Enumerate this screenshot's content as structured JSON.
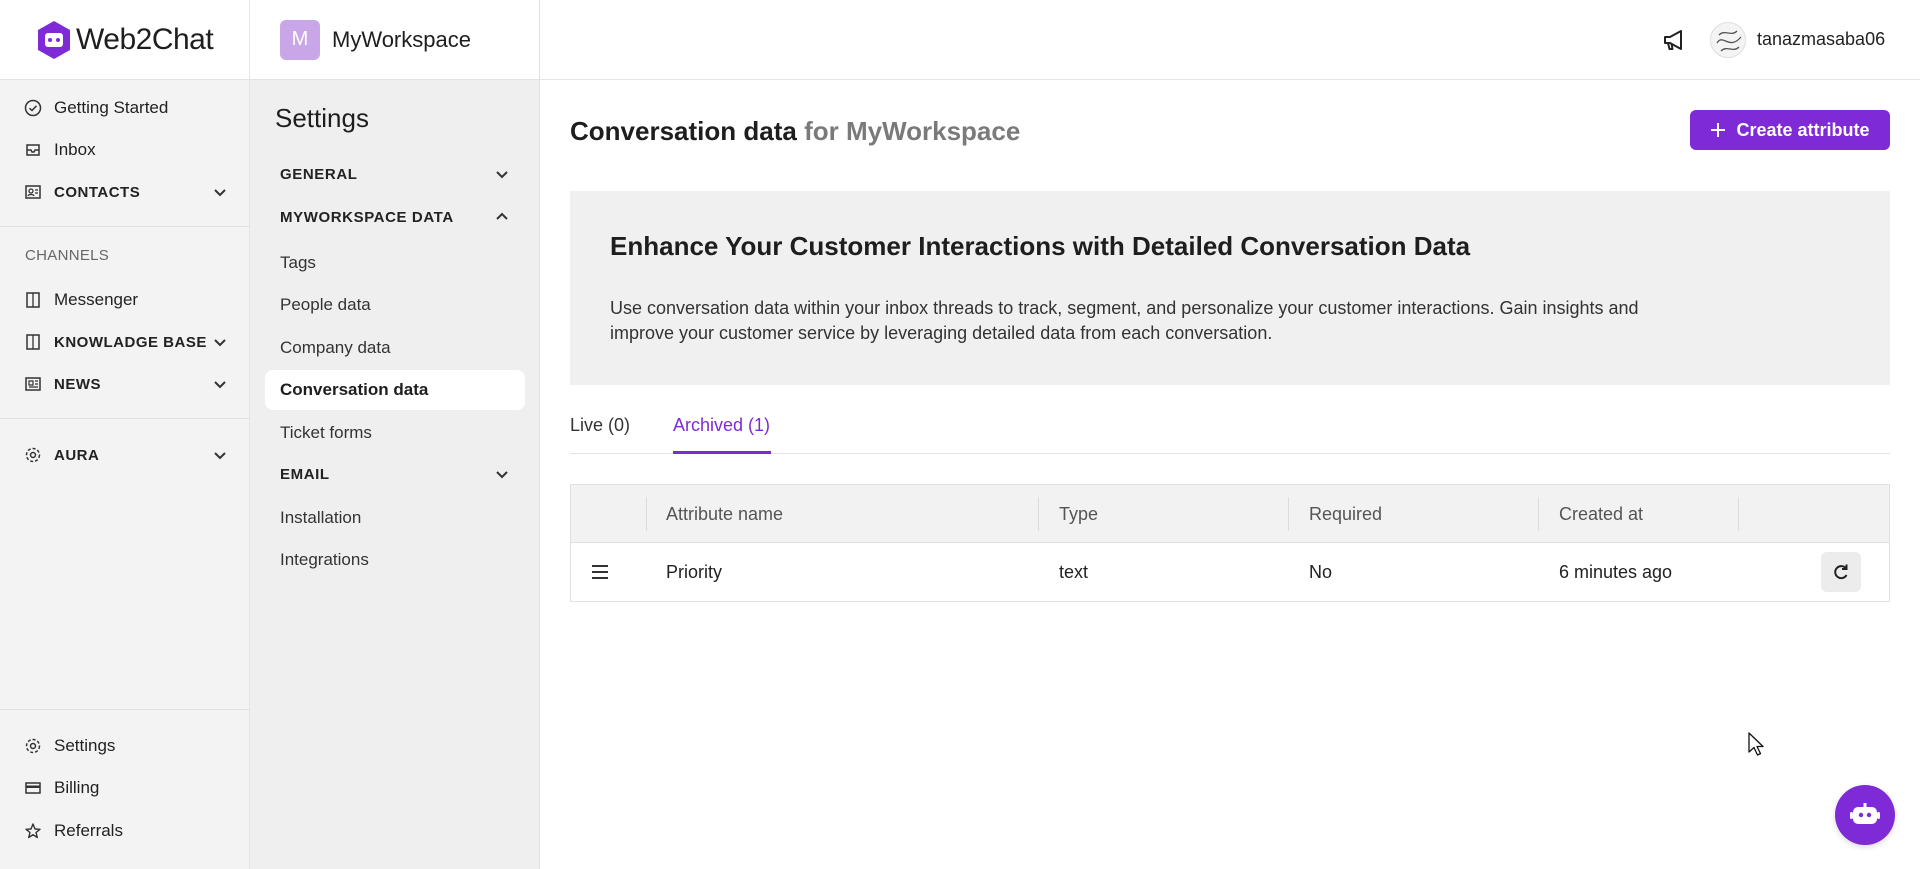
{
  "brand": {
    "name": "Web2Chat",
    "accent": "#7e2ad6"
  },
  "nav": {
    "getting_started": "Getting Started",
    "inbox": "Inbox",
    "contacts": "CONTACTS",
    "channels_header": "CHANNELS",
    "messenger": "Messenger",
    "knowledge_base": "KNOWLADGE BASE",
    "news": "NEWS",
    "aura": "AURA",
    "settings": "Settings",
    "billing": "Billing",
    "referrals": "Referrals"
  },
  "workspace": {
    "initial": "M",
    "name": "MyWorkspace"
  },
  "settings_menu": {
    "title": "Settings",
    "general": "GENERAL",
    "workspace_data": "MYWORKSPACE DATA",
    "tags": "Tags",
    "people_data": "People data",
    "company_data": "Company data",
    "conversation_data": "Conversation data",
    "ticket_forms": "Ticket forms",
    "email": "EMAIL",
    "installation": "Installation",
    "integrations": "Integrations"
  },
  "user": {
    "name": "tanazmasaba06"
  },
  "page": {
    "title": "Conversation data",
    "title_suffix": "for MyWorkspace",
    "create_button": "Create attribute"
  },
  "banner": {
    "heading": "Enhance Your Customer Interactions with Detailed Conversation Data",
    "body": "Use conversation data within your inbox threads to track, segment, and personalize your customer interactions. Gain insights and improve your customer service by leveraging detailed data from each conversation."
  },
  "tabs": {
    "live": "Live (0)",
    "archived": "Archived (1)",
    "active": "archived"
  },
  "table": {
    "columns": {
      "name": "Attribute name",
      "type": "Type",
      "required": "Required",
      "created": "Created at"
    },
    "rows": [
      {
        "name": "Priority",
        "type": "text",
        "required": "No",
        "created": "6 minutes ago"
      }
    ]
  },
  "icons": {
    "nav": [
      "check-circle-icon",
      "inbox-icon",
      "contacts-icon",
      "messenger-icon",
      "book-icon",
      "news-icon",
      "gear-icon",
      "credit-card-icon",
      "star-icon"
    ],
    "topbar": [
      "megaphone-icon"
    ],
    "row": [
      "drag-handle-icon",
      "restore-icon"
    ],
    "fab": "chatbot-icon"
  }
}
